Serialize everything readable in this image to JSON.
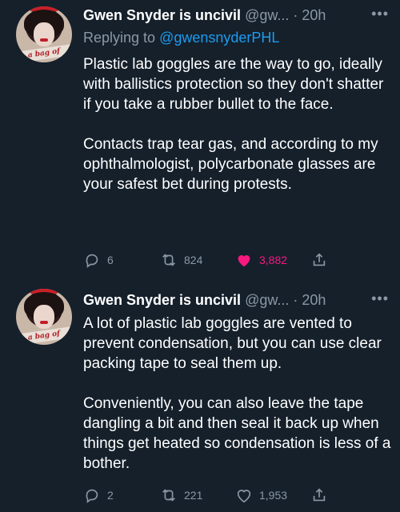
{
  "tweets": [
    {
      "name": "Gwen Snyder is uncivil",
      "handle": "@gw...",
      "time": "20h",
      "more": "•••",
      "replying_prefix": "Replying to ",
      "replying_to": "@gwensnyderPHL",
      "avatar_text": "a bag of",
      "paragraphs": [
        "Plastic lab goggles are the way to go, ideally with ballistics protection so they don't shatter if you take a rubber bullet to the face.",
        "Contacts trap tear gas, and according to my ophthalmologist, polycarbonate glasses are your safest bet during protests."
      ],
      "replies": "6",
      "retweets": "824",
      "likes": "3,882",
      "liked": true
    },
    {
      "name": "Gwen Snyder is uncivil",
      "handle": "@gw...",
      "time": "20h",
      "more": "•••",
      "avatar_text": "a bag of",
      "paragraphs": [
        "A lot of plastic lab goggles are vented to prevent condensation, but you can use clear packing tape to seal them up.",
        "Conveniently, you can also leave the tape dangling a bit and then seal it back up when things get heated so condensation is less of a bother."
      ],
      "replies": "2",
      "retweets": "221",
      "likes": "1,953",
      "liked": false
    }
  ],
  "icons": {
    "reply": "reply-icon",
    "retweet": "retweet-icon",
    "like": "heart-icon",
    "share": "share-icon"
  },
  "colors": {
    "background": "#15202b",
    "secondary_text": "#8b98a5",
    "link": "#1d9bf0",
    "like": "#f91880"
  }
}
